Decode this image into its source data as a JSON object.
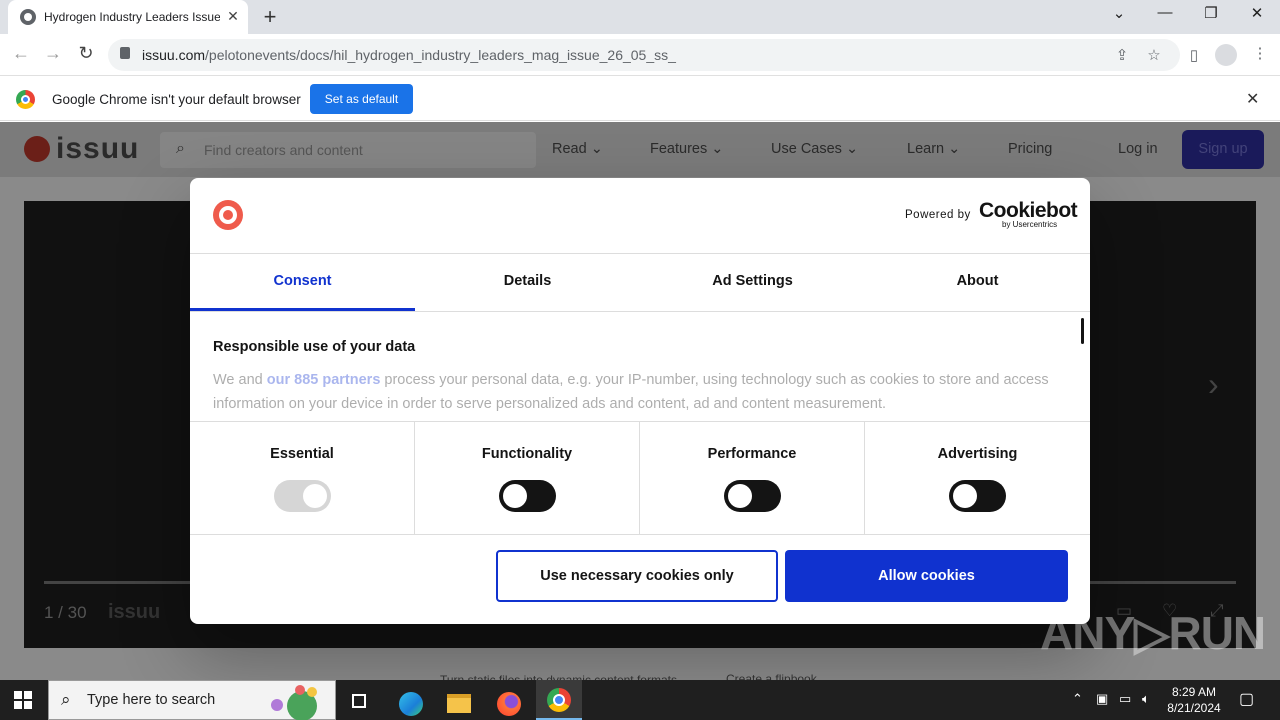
{
  "browser": {
    "tab_title": "Hydrogen Industry Leaders Issue",
    "tab_close": "✕",
    "new_tab": "+",
    "window_controls": [
      "⌄",
      "—",
      "❐",
      "✕"
    ],
    "url_host": "issuu.com",
    "url_path": "/pelotonevents/docs/hil_hydrogen_industry_leaders_mag_issue_26_05_ss_",
    "nav": {
      "back": "←",
      "forward": "→",
      "reload": "↻"
    },
    "omni_icons": [
      "share-icon",
      "star-icon",
      "sidepanel-icon",
      "profile-icon",
      "menu-icon"
    ]
  },
  "infobar": {
    "message": "Google Chrome isn't your default browser",
    "button": "Set as default",
    "close": "✕"
  },
  "site": {
    "logo_text": "issuu",
    "search_placeholder": "Find creators and content",
    "nav": [
      "Read",
      "Features",
      "Use Cases",
      "Learn",
      "Pricing"
    ],
    "login": "Log in",
    "signup": "Sign up",
    "viewer": {
      "page": "1 / 30",
      "logo": "issuu"
    },
    "footer_text": "Turn static files into dynamic content formats.",
    "footer_link": "Create a flipbook"
  },
  "consent": {
    "powered_by": "Powered by",
    "brand": "Cookiebot",
    "brand_sub": "by Usercentrics",
    "tabs": [
      "Consent",
      "Details",
      "Ad Settings",
      "About"
    ],
    "active_tab": "Consent",
    "heading": "Responsible use of your data",
    "body_pre": "We and ",
    "body_link": "our 885 partners",
    "body_post": " process your personal data, e.g. your IP-number, using technology such as cookies to store and access information on your device in order to serve personalized ads and content, ad and content measurement.",
    "categories": [
      {
        "label": "Essential",
        "checked": true,
        "disabled": true
      },
      {
        "label": "Functionality",
        "checked": false
      },
      {
        "label": "Performance",
        "checked": false
      },
      {
        "label": "Advertising",
        "checked": false
      }
    ],
    "btn_necessary": "Use necessary cookies only",
    "btn_allow": "Allow cookies",
    "accent_color": "#1032cf"
  },
  "watermark": "ANY▷RUN",
  "taskbar": {
    "search_placeholder": "Type here to search",
    "time": "8:29 AM",
    "date": "8/21/2024",
    "apps": [
      "task-view-icon",
      "edge-icon",
      "file-explorer-icon",
      "firefox-icon",
      "chrome-icon"
    ]
  }
}
